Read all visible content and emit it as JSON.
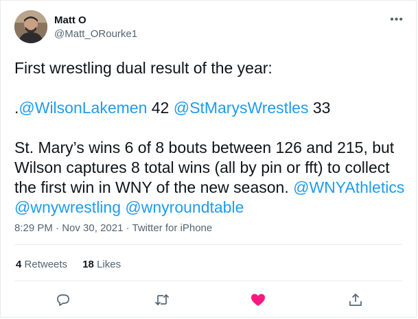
{
  "author": {
    "name": "Matt O",
    "handle": "@Matt_ORourke1"
  },
  "tweet": {
    "line1": "First wrestling dual result of the year:",
    "score_prefix": ".",
    "team1_mention": "@WilsonLakemen",
    "team1_score": " 42 ",
    "team2_mention": "@StMarysWrestles",
    "team2_score": " 33",
    "para3_text": "St. Mary’s wins 6 of 8 bouts between 126 and 215, but Wilson captures 8 total wins (all by pin or fft) to collect the first win in WNY of the new season. ",
    "mention_wnyathletics": "@WNYAthletics",
    "mention_wnywrestling": "@wnywrestling",
    "mention_wnyroundtable": "@wnyroundtable"
  },
  "meta": {
    "time": "8:29 PM",
    "date": "Nov 30, 2021",
    "source": "Twitter for iPhone",
    "separator": " · "
  },
  "stats": {
    "retweets_count": "4",
    "retweets_label": "Retweets",
    "likes_count": "18",
    "likes_label": "Likes"
  },
  "actions": {
    "reply_icon": "reply-icon",
    "retweet_icon": "retweet-icon",
    "like_icon": "heart-icon",
    "share_icon": "share-icon"
  },
  "colors": {
    "link": "#1d9bf0",
    "like_active": "#f91880",
    "secondary_text": "#536471"
  }
}
